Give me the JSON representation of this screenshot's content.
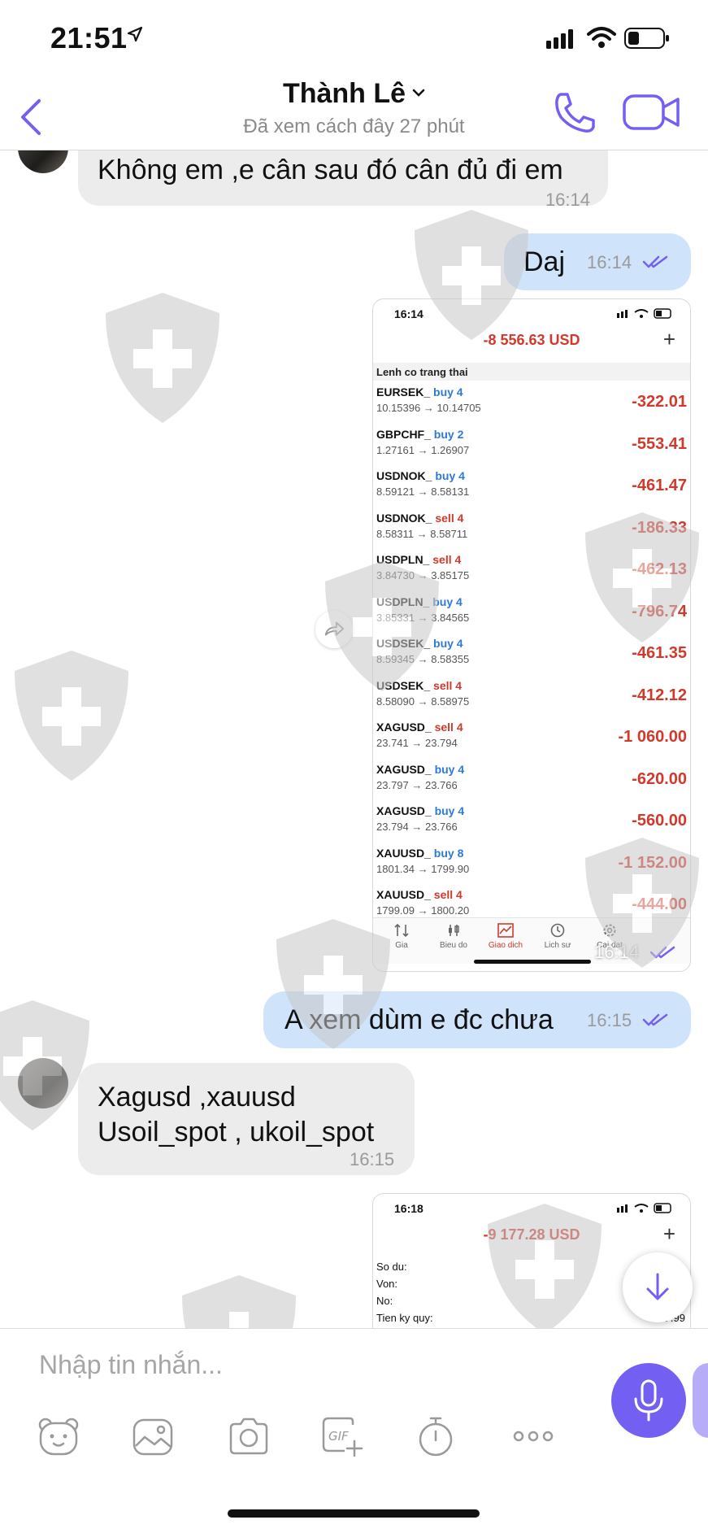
{
  "status_bar": {
    "time": "21:51"
  },
  "header": {
    "contact_name": "Thành Lê",
    "last_seen": "Đã xem cách đây 27 phút"
  },
  "messages": [
    {
      "dir": "in",
      "text": "Không em ,e cân sau đó cân đủ đi em",
      "time": "16:14"
    },
    {
      "dir": "out",
      "text": "Daj",
      "time": "16:14"
    },
    {
      "dir": "out",
      "type": "screenshot",
      "time": "16:14"
    },
    {
      "dir": "out",
      "text": "A xem dùm e đc chưa",
      "time": "16:15"
    },
    {
      "dir": "in",
      "text_line1": "Xagusd ,xauusd",
      "text_line2": "Usoil_spot , ukoil_spot",
      "time": "16:15"
    }
  ],
  "screenshot1": {
    "time": "16:14",
    "total": "-8 556.63 USD",
    "section": "Lenh co trang thai",
    "orders": [
      {
        "sym": "EURSEK_",
        "side": "buy 4",
        "prices": "10.15396 → 10.14705",
        "pnl": "-322.01"
      },
      {
        "sym": "GBPCHF_",
        "side": "buy 2",
        "prices": "1.27161 → 1.26907",
        "pnl": "-553.41"
      },
      {
        "sym": "USDNOK_",
        "side": "buy 4",
        "prices": "8.59121 → 8.58131",
        "pnl": "-461.47"
      },
      {
        "sym": "USDNOK_",
        "side": "sell 4",
        "prices": "8.58311 → 8.58711",
        "pnl": "-186.33"
      },
      {
        "sym": "USDPLN_",
        "side": "sell 4",
        "prices": "3.84730 → 3.85175",
        "pnl": "-462.13"
      },
      {
        "sym": "USDPLN_",
        "side": "buy 4",
        "prices": "3.85331 → 3.84565",
        "pnl": "-796.74"
      },
      {
        "sym": "USDSEK_",
        "side": "buy 4",
        "prices": "8.59345 → 8.58355",
        "pnl": "-461.35"
      },
      {
        "sym": "USDSEK_",
        "side": "sell 4",
        "prices": "8.58090 → 8.58975",
        "pnl": "-412.12"
      },
      {
        "sym": "XAGUSD_",
        "side": "sell 4",
        "prices": "23.741 → 23.794",
        "pnl": "-1 060.00"
      },
      {
        "sym": "XAGUSD_",
        "side": "buy 4",
        "prices": "23.797 → 23.766",
        "pnl": "-620.00"
      },
      {
        "sym": "XAGUSD_",
        "side": "buy 4",
        "prices": "23.794 → 23.766",
        "pnl": "-560.00"
      },
      {
        "sym": "XAUUSD_",
        "side": "buy 8",
        "prices": "1801.34 → 1799.90",
        "pnl": "-1 152.00"
      },
      {
        "sym": "XAUUSD_",
        "side": "sell 4",
        "prices": "1799.09 → 1800.20",
        "pnl": "-444.00"
      }
    ],
    "tabs": [
      "Gia",
      "Bieu do",
      "Giao dich",
      "Lich sư",
      "Cai dat"
    ]
  },
  "screenshot2": {
    "time": "16:18",
    "total": "-9 177.28 USD",
    "rows": [
      "So du:",
      "Von:",
      "No:",
      "Tien ky quy:"
    ],
    "partial_value": "1 .99"
  },
  "composer": {
    "placeholder": "Nhập tin nhắn..."
  },
  "colors": {
    "accent": "#7360f2",
    "outgoing_bubble": "#cfe3fa",
    "incoming_bubble": "#ececec",
    "loss": "#d0392b",
    "buy": "#2d7ad6"
  }
}
